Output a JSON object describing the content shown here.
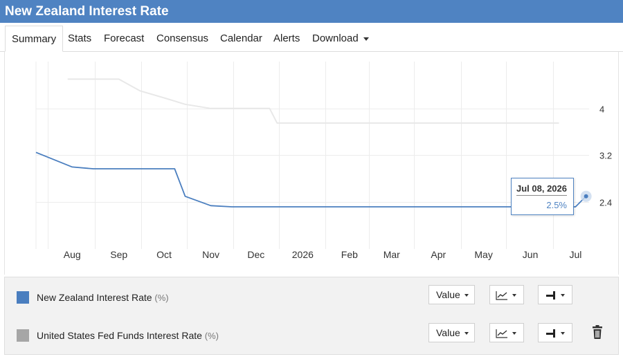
{
  "header": {
    "title": "New Zealand Interest Rate"
  },
  "tabs": [
    "Summary",
    "Stats",
    "Forecast",
    "Consensus",
    "Calendar",
    "Alerts",
    "Download"
  ],
  "tooltip": {
    "date": "Jul 08, 2026",
    "value": "2.5%"
  },
  "legend": {
    "rows": [
      {
        "name": "New Zealand Interest Rate",
        "unit": "(%)",
        "color": "#4a7ebf"
      },
      {
        "name": "United States Fed Funds Interest Rate",
        "unit": "(%)",
        "color": "#a6a6a6"
      }
    ],
    "value_label": "Value"
  },
  "colors": {
    "header": "#4f83c2",
    "nz_line": "#4a7ebf",
    "us_line": "#e8e8e8"
  },
  "chart_data": {
    "type": "line",
    "x_tick_labels": [
      "Aug",
      "Sep",
      "Oct",
      "Nov",
      "Dec",
      "2026",
      "Feb",
      "Mar",
      "Apr",
      "May",
      "Jun",
      "Jul"
    ],
    "y_ticks": [
      2.4,
      3.2,
      4
    ],
    "ylim": [
      1.6,
      4.8
    ],
    "y_axis_side": "right",
    "grid": true,
    "series": [
      {
        "name": "New Zealand Interest Rate",
        "x": [
          "2025-07-08",
          "2025-08-01",
          "2025-08-15",
          "2025-09-01",
          "2025-09-15",
          "2025-10-01",
          "2025-10-08",
          "2025-10-15",
          "2025-11-01",
          "2025-11-15",
          "2025-12-01",
          "2026-01-01",
          "2026-02-01",
          "2026-03-01",
          "2026-04-01",
          "2026-05-01",
          "2026-06-01",
          "2026-07-01",
          "2026-07-08"
        ],
        "y": [
          3.25,
          3.0,
          2.97,
          2.97,
          2.97,
          2.97,
          2.97,
          2.5,
          2.34,
          2.32,
          2.32,
          2.32,
          2.32,
          2.32,
          2.32,
          2.32,
          2.32,
          2.32,
          2.5
        ]
      },
      {
        "name": "United States Fed Funds Interest Rate",
        "x": [
          "2025-07-29",
          "2025-08-15",
          "2025-09-01",
          "2025-09-15",
          "2025-10-01",
          "2025-10-15",
          "2025-11-01",
          "2025-11-15",
          "2025-12-01",
          "2025-12-10",
          "2025-12-15",
          "2026-01-01",
          "2026-02-01",
          "2026-03-01",
          "2026-04-01",
          "2026-05-01",
          "2026-06-01",
          "2026-06-20"
        ],
        "y": [
          4.5,
          4.5,
          4.5,
          4.3,
          4.18,
          4.07,
          4.0,
          4.0,
          4.0,
          4.0,
          3.75,
          3.75,
          3.75,
          3.75,
          3.75,
          3.75,
          3.75,
          3.75
        ]
      }
    ]
  }
}
